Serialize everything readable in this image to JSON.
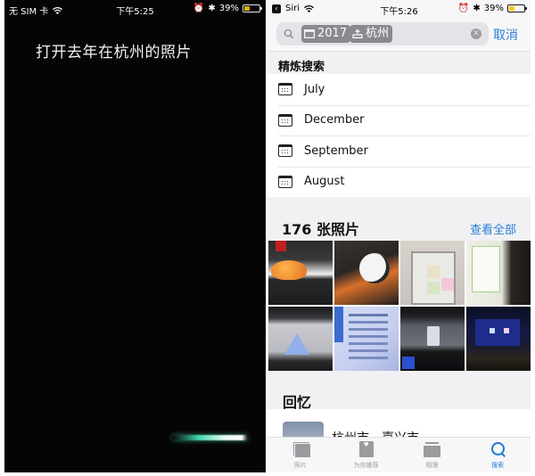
{
  "siri_screen": {
    "status_bar": {
      "carrier": "无 SIM 卡",
      "time": "下午5:25",
      "battery": "39%",
      "battery_level": 0.39
    },
    "query": "打开去年在杭州的照片",
    "listening_wave": "siri-waveform"
  },
  "photos_screen": {
    "status_bar": {
      "back_app": "Siri",
      "time": "下午5:26",
      "battery": "39%",
      "battery_level": 0.39
    },
    "search": {
      "tokens": [
        {
          "icon": "calendar-icon",
          "label": "2017"
        },
        {
          "icon": "location-icon",
          "label": "杭州"
        }
      ],
      "cancel_label": "取消"
    },
    "refine": {
      "header": "精炼搜索",
      "items": [
        {
          "icon": "calendar-icon",
          "label": "July"
        },
        {
          "icon": "calendar-icon",
          "label": "December"
        },
        {
          "icon": "calendar-icon",
          "label": "September"
        },
        {
          "icon": "calendar-icon",
          "label": "August"
        }
      ]
    },
    "photos_section": {
      "title": "176 张照片",
      "see_all_label": "查看全部",
      "thumbnails": [
        "photo-toys-shelf",
        "photo-panda-mascot",
        "photo-fridge-notes",
        "photo-poster-board",
        "photo-projector-pyramid",
        "photo-slide-document",
        "photo-presentation-screen",
        "photo-conference-stage"
      ]
    },
    "memories": {
      "title": "回忆",
      "first_item_title": "杭州市，嘉兴市"
    },
    "tab_bar": {
      "tabs": [
        {
          "icon": "photos-icon",
          "label": "照片",
          "active": false
        },
        {
          "icon": "for-you-icon",
          "label": "为你推荐",
          "active": false
        },
        {
          "icon": "albums-icon",
          "label": "相簿",
          "active": false
        },
        {
          "icon": "search-icon",
          "label": "搜索",
          "active": true
        }
      ]
    },
    "colors": {
      "accent": "#2a7fd6",
      "token_bg": "#8a8a8e",
      "inactive_tab": "#9b9b9f"
    }
  }
}
